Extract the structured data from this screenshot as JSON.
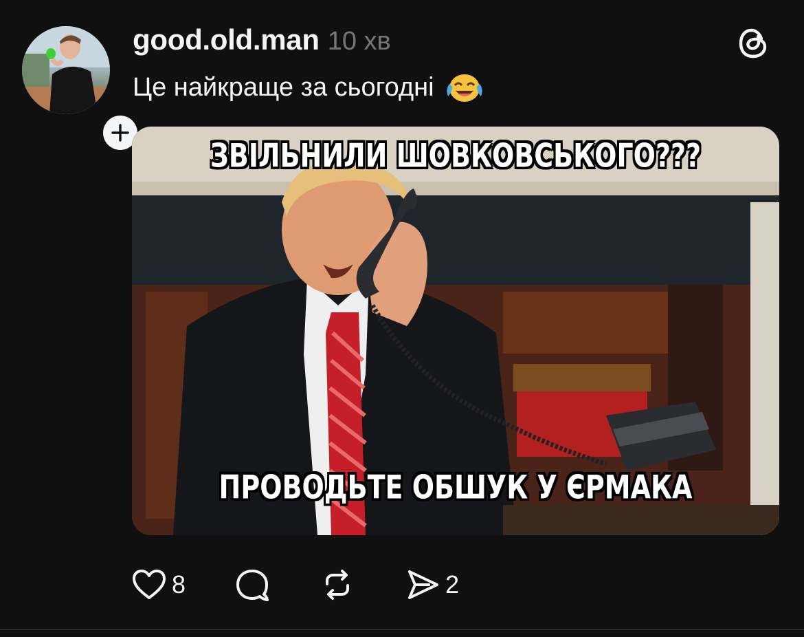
{
  "post": {
    "username": "good.old.man",
    "time": "10 хв",
    "caption": "Це найкраще за сьогодні",
    "caption_emoji": "face-with-tears-of-joy-emoji",
    "media": {
      "top_text": "ЗВІЛЬНИЛИ ШОВКОВСЬКОГО???",
      "bottom_text": "ПРОВОДЬТЕ ОБШУК У ЄРМАКА"
    },
    "actions": {
      "likes": "8",
      "reposts_shares": "2"
    }
  },
  "icons": {
    "follow": "plus-icon",
    "app_logo": "threads-logo-icon",
    "like": "heart-icon",
    "reply": "comment-bubble-icon",
    "repost": "repost-icon",
    "share": "send-icon"
  },
  "colors": {
    "background": "#101010",
    "text": "#f3f5f7",
    "muted": "#777777"
  }
}
